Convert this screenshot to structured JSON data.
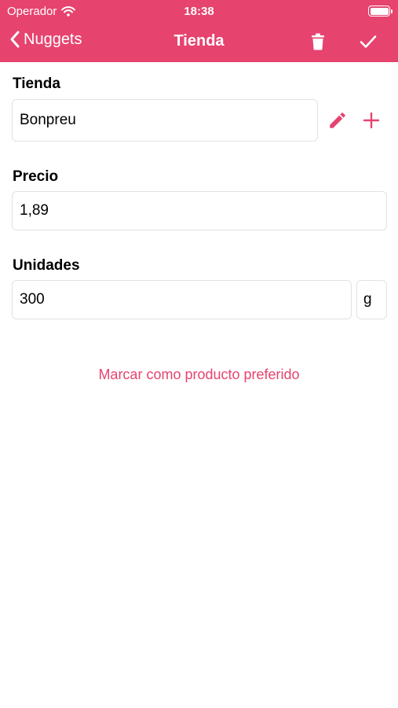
{
  "status_bar": {
    "carrier": "Operador",
    "time": "18:38"
  },
  "nav": {
    "back_label": "Nuggets",
    "title": "Tienda"
  },
  "form": {
    "store": {
      "label": "Tienda",
      "value": "Bonpreu"
    },
    "price": {
      "label": "Precio",
      "value": "1,89"
    },
    "units": {
      "label": "Unidades",
      "value": "300",
      "unit": "g"
    }
  },
  "actions": {
    "favorite_label": "Marcar como producto preferido"
  },
  "colors": {
    "accent": "#e6436f",
    "field_border": "#e2e2e2",
    "background": "#ffffff"
  },
  "icons": [
    "wifi-icon",
    "battery-icon",
    "chevron-left-icon",
    "trash-icon",
    "checkmark-icon",
    "pencil-icon",
    "plus-icon"
  ]
}
